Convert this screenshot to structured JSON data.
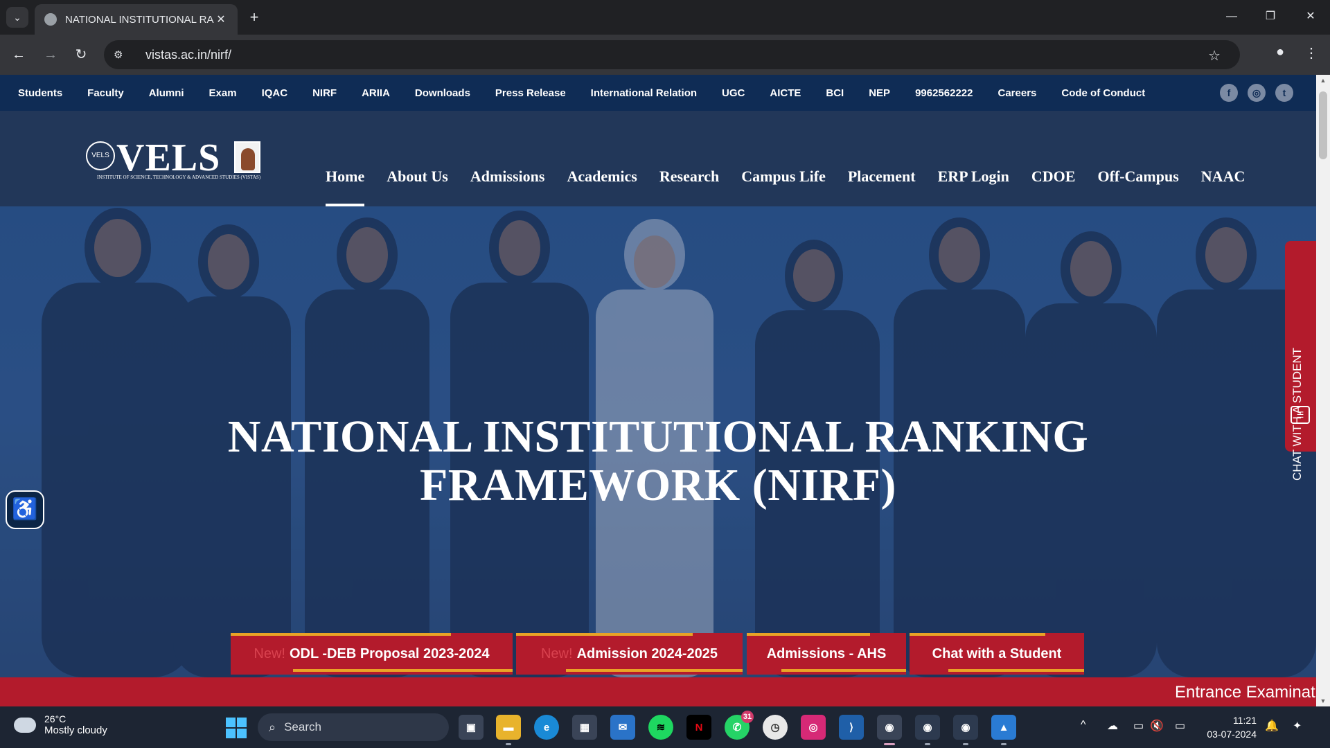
{
  "browser": {
    "tab_title": "NATIONAL INSTITUTIONAL RAN",
    "url": "vistas.ac.in/nirf/",
    "new_tab_label": "+",
    "tab_close_label": "✕"
  },
  "topbar": {
    "links": [
      "Students",
      "Faculty",
      "Alumni",
      "Exam",
      "IQAC",
      "NIRF",
      "ARIIA",
      "Downloads",
      "Press Release",
      "International Relation",
      "UGC",
      "AICTE",
      "BCI",
      "NEP",
      "9962562222",
      "Careers",
      "Code of Conduct"
    ],
    "social": [
      "f",
      "◎",
      "t"
    ]
  },
  "logo": {
    "wordmark": "VELS",
    "badge": "VELS",
    "tagline": "INSTITUTE OF SCIENCE, TECHNOLOGY & ADVANCED STUDIES (VISTAS)"
  },
  "mainnav": {
    "items": [
      "Home",
      "About Us",
      "Admissions",
      "Academics",
      "Research",
      "Campus Life",
      "Placement",
      "ERP Login",
      "CDOE",
      "Off-Campus",
      "NAAC"
    ],
    "active": "Home"
  },
  "hero": {
    "title_line1": "NATIONAL INSTITUTIONAL RANKING",
    "title_line2": "FRAMEWORK (NIRF)"
  },
  "quicklinks": [
    {
      "new": "New!",
      "label": "ODL -DEB Proposal 2023-2024"
    },
    {
      "new": "New!",
      "label": "Admission 2024-2025"
    },
    {
      "new": "",
      "label": "Admissions - AHS"
    },
    {
      "new": "",
      "label": "Chat with a Student"
    }
  ],
  "marquee": {
    "text": "Entrance Examination"
  },
  "chat_side": {
    "label": "CHAT WITH A STUDENT"
  },
  "taskbar": {
    "weather_temp": "26°C",
    "weather_desc": "Mostly cloudy",
    "search_label": "Search",
    "whatsapp_badge": "31",
    "time": "11:21",
    "date": "03-07-2024"
  },
  "colors": {
    "topbar_bg": "#0f2c55",
    "header_bg": "#223759",
    "accent_red": "#b31b2c",
    "accent_gold": "#e9a326"
  }
}
